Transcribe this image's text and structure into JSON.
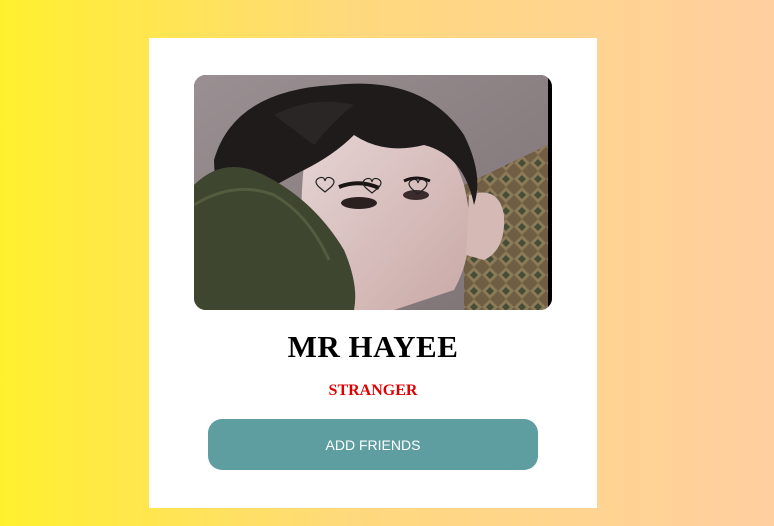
{
  "profile": {
    "name": "MR HAYEE",
    "status": "STRANGER",
    "photo_icon": "profile-photo"
  },
  "actions": {
    "add_friends_label": "ADD FRIENDS"
  },
  "colors": {
    "background_start": "#fff02e",
    "background_end": "#ffcfa0",
    "card": "#ffffff",
    "status": "#e00000",
    "button": "#5f9ea0",
    "button_text": "#ffffff"
  }
}
